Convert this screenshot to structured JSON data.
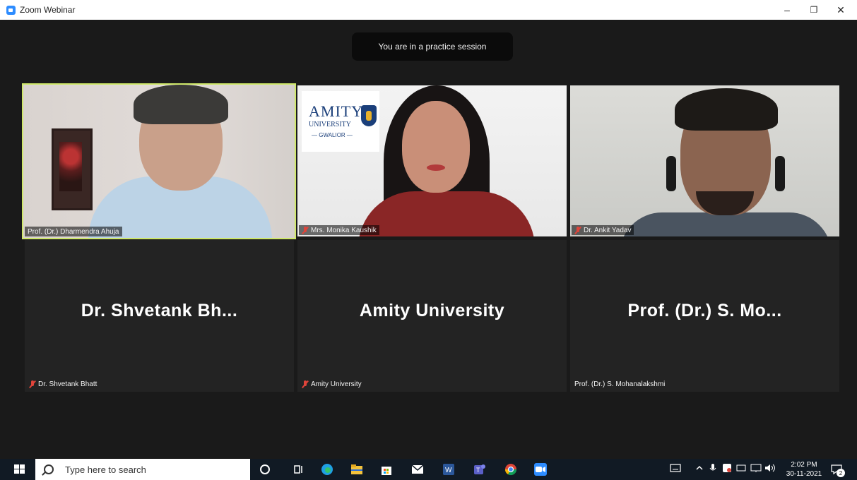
{
  "window": {
    "title": "Zoom Webinar",
    "controls": {
      "minimize": "–",
      "restore": "❐",
      "close": "✕"
    }
  },
  "banner": {
    "text": "You are in a practice session"
  },
  "participants": [
    {
      "name": "Prof. (Dr.) Dharmendra Ahuja",
      "video": true,
      "muted": false,
      "active_speaker": true
    },
    {
      "name": "Mrs. Monika Kaushik",
      "video": true,
      "muted": true
    },
    {
      "name": "Dr. Ankit Yadav",
      "video": true,
      "muted": true
    },
    {
      "name": "Dr. Shvetank Bhatt",
      "display": "Dr. Shvetank Bh...",
      "video": false,
      "muted": true
    },
    {
      "name": "Amity University",
      "display": "Amity University",
      "video": false,
      "muted": true
    },
    {
      "name": "Prof. (Dr.) S. Mohanalakshmi",
      "display": "Prof. (Dr.) S. Mo...",
      "video": false,
      "muted": false
    }
  ],
  "video_overlay": {
    "logo_text": "AMITY",
    "logo_sub": "UNIVERSITY",
    "logo_sub2": "— GWALIOR —"
  },
  "taskbar": {
    "search_placeholder": "Type here to search",
    "time": "2:02 PM",
    "date": "30-11-2021",
    "notification_count": "2",
    "icons": [
      "start-icon",
      "cortana-icon",
      "task-view-icon",
      "edge-icon",
      "file-explorer-icon",
      "store-icon",
      "mail-icon",
      "word-icon",
      "teams-icon",
      "chrome-icon",
      "zoom-icon"
    ]
  },
  "colors": {
    "active_speaker_border": "#cfe86a",
    "muted_icon": "#e0443a",
    "zoom_blue": "#2d8cff",
    "stage_bg": "#1a1a1a",
    "tile_bg": "#232323"
  }
}
